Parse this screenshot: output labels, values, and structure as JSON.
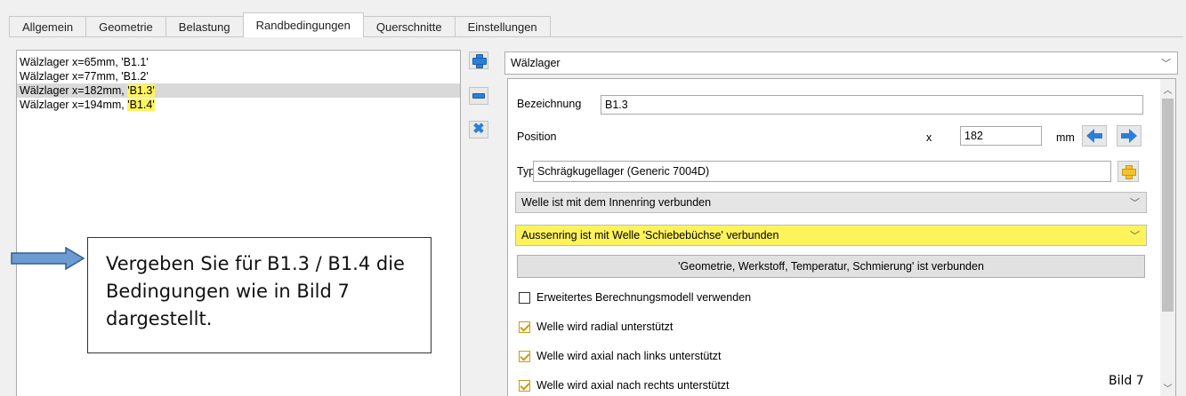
{
  "tabs": [
    {
      "label": "Allgemein",
      "active": false
    },
    {
      "label": "Geometrie",
      "active": false
    },
    {
      "label": "Belastung",
      "active": false
    },
    {
      "label": "Randbedingungen",
      "active": true
    },
    {
      "label": "Querschnitte",
      "active": false
    },
    {
      "label": "Einstellungen",
      "active": false
    }
  ],
  "list": {
    "items": [
      {
        "prefix": "Wälzlager x=65mm, ",
        "name": "'B1.1'",
        "highlight": false,
        "selected": false
      },
      {
        "prefix": "Wälzlager x=77mm, ",
        "name": "'B1.2'",
        "highlight": false,
        "selected": false
      },
      {
        "prefix": "Wälzlager x=182mm, ",
        "name": "'B1.3'",
        "highlight": true,
        "selected": true
      },
      {
        "prefix": "Wälzlager x=194mm, ",
        "name": "'B1.4'",
        "highlight": true,
        "selected": false
      }
    ]
  },
  "side_buttons": {
    "add_icon": "plus-icon",
    "remove_icon": "minus-icon",
    "delete_icon": "x-icon"
  },
  "type_select": {
    "value": "Wälzlager"
  },
  "form": {
    "bezeichnung_label": "Bezeichnung",
    "bezeichnung_value": "B1.3",
    "position_label": "Position",
    "position_axis": "x",
    "position_value": "182",
    "position_unit": "mm",
    "typ_label": "Typ",
    "typ_value": "Schrägkugellager (Generic 7004D)",
    "inner_ring_select": "Welle ist mit dem Innenring verbunden",
    "outer_ring_select": "Aussenring ist mit Welle 'Schiebebüchse' verbunden",
    "connected_button": "'Geometrie, Werkstoff, Temperatur, Schmierung' ist verbunden",
    "checkboxes": [
      {
        "label": "Erweitertes Berechnungsmodell verwenden",
        "checked": false
      },
      {
        "label": "Welle wird radial unterstützt",
        "checked": true
      },
      {
        "label": "Welle wird axial nach links unterstützt",
        "checked": true
      },
      {
        "label": "Welle wird axial nach rechts unterstützt",
        "checked": true
      }
    ]
  },
  "callout": {
    "text": "Vergeben Sie für B1.3 / B1.4 die Bedingungen wie in Bild 7 dargestellt."
  },
  "figure_label": "Bild 7",
  "colors": {
    "highlight": "#fff35c",
    "accent_blue": "#2b7fd6",
    "accent_yellow": "#f2c230"
  }
}
